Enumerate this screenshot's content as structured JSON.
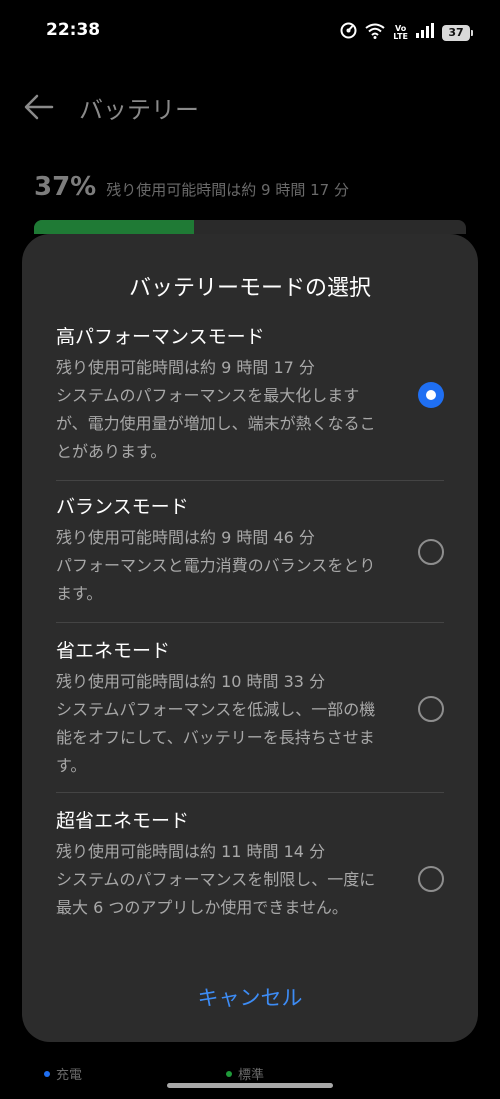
{
  "status_bar": {
    "time": "22:38",
    "network_label": "Vo\nLTE",
    "battery_level": "37"
  },
  "header": {
    "title": "バッテリー",
    "back_icon": "arrow-left-icon"
  },
  "battery": {
    "percent": "37%",
    "remaining": "残り使用可能時間は約 9 時間 17 分",
    "level_fraction": 0.37,
    "bar_color": "#1f7a35"
  },
  "legend": [
    {
      "label": "充電",
      "color": "#1f6ff2"
    },
    {
      "label": "標準",
      "color": "#1f9a3a"
    }
  ],
  "dialog": {
    "title": "バッテリーモードの選択",
    "options": [
      {
        "title": "高パフォーマンスモード",
        "desc": "残り使用可能時間は約 9 時間 17 分\nシステムのパフォーマンスを最大化しますが、電力使用量が増加し、端末が熱くなることがあります。",
        "selected": true
      },
      {
        "title": "バランスモード",
        "desc": "残り使用可能時間は約 9 時間 46 分\nパフォーマンスと電力消費のバランスをとります。",
        "selected": false
      },
      {
        "title": "省エネモード",
        "desc": "残り使用可能時間は約 10 時間 33 分\nシステムパフォーマンスを低減し、一部の機能をオフにして、バッテリーを長持ちさせます。",
        "selected": false
      },
      {
        "title": "超省エネモード",
        "desc": "残り使用可能時間は約 11 時間 14 分\nシステムのパフォーマンスを制限し、一度に最大 6 つのアプリしか使用できません。",
        "selected": false
      }
    ],
    "cancel_label": "キャンセル"
  },
  "colors": {
    "accent": "#1f6ff2",
    "cancel_text": "#3d8cf5",
    "dialog_bg": "#2c2c2c"
  }
}
